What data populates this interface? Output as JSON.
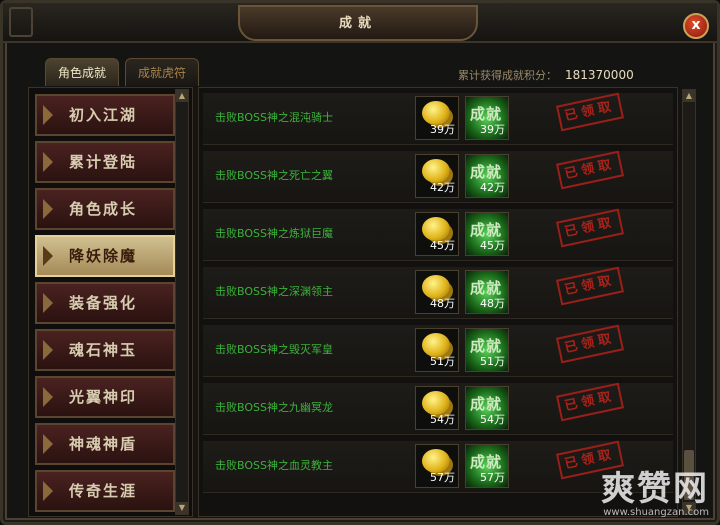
{
  "window": {
    "title": "成就",
    "close_icon": "close-icon",
    "close_label": "x"
  },
  "tabs": [
    {
      "label": "角色成就",
      "active": true
    },
    {
      "label": "成就虎符",
      "active": false
    }
  ],
  "summary": {
    "label": "累计获得成就积分：",
    "value": "181370000"
  },
  "categories": [
    {
      "label": "初入江湖",
      "selected": false
    },
    {
      "label": "累计登陆",
      "selected": false
    },
    {
      "label": "角色成长",
      "selected": false
    },
    {
      "label": "降妖除魔",
      "selected": true
    },
    {
      "label": "装备强化",
      "selected": false
    },
    {
      "label": "魂石神玉",
      "selected": false
    },
    {
      "label": "光翼神印",
      "selected": false
    },
    {
      "label": "神魂神盾",
      "selected": false
    },
    {
      "label": "传奇生涯",
      "selected": false
    }
  ],
  "achievements": [
    {
      "name": "击败BOSS神之混沌骑士",
      "gold_reward": "39万",
      "points_reward": "39万",
      "icon_label": "成就",
      "status": "已领取"
    },
    {
      "name": "击败BOSS神之死亡之翼",
      "gold_reward": "42万",
      "points_reward": "42万",
      "icon_label": "成就",
      "status": "已领取"
    },
    {
      "name": "击败BOSS神之炼狱巨魔",
      "gold_reward": "45万",
      "points_reward": "45万",
      "icon_label": "成就",
      "status": "已领取"
    },
    {
      "name": "击败BOSS神之深渊领主",
      "gold_reward": "48万",
      "points_reward": "48万",
      "icon_label": "成就",
      "status": "已领取"
    },
    {
      "name": "击败BOSS神之毁灭军皇",
      "gold_reward": "51万",
      "points_reward": "51万",
      "icon_label": "成就",
      "status": "已领取"
    },
    {
      "name": "击败BOSS神之九幽冥龙",
      "gold_reward": "54万",
      "points_reward": "54万",
      "icon_label": "成就",
      "status": "已领取"
    },
    {
      "name": "击败BOSS神之血灵教主",
      "gold_reward": "57万",
      "points_reward": "57万",
      "icon_label": "成就",
      "status": "已领取"
    }
  ],
  "icons": {
    "up": "▲",
    "down": "▼",
    "coin": "gold-coin-icon",
    "achievement": "achievement-icon"
  },
  "watermark": {
    "main": "爽赞网",
    "sub": "www.shuangzan.com"
  },
  "colors": {
    "name_green": "#3bb33b",
    "stamp_red": "#b8241c",
    "selected_tab": "#d0c090"
  }
}
